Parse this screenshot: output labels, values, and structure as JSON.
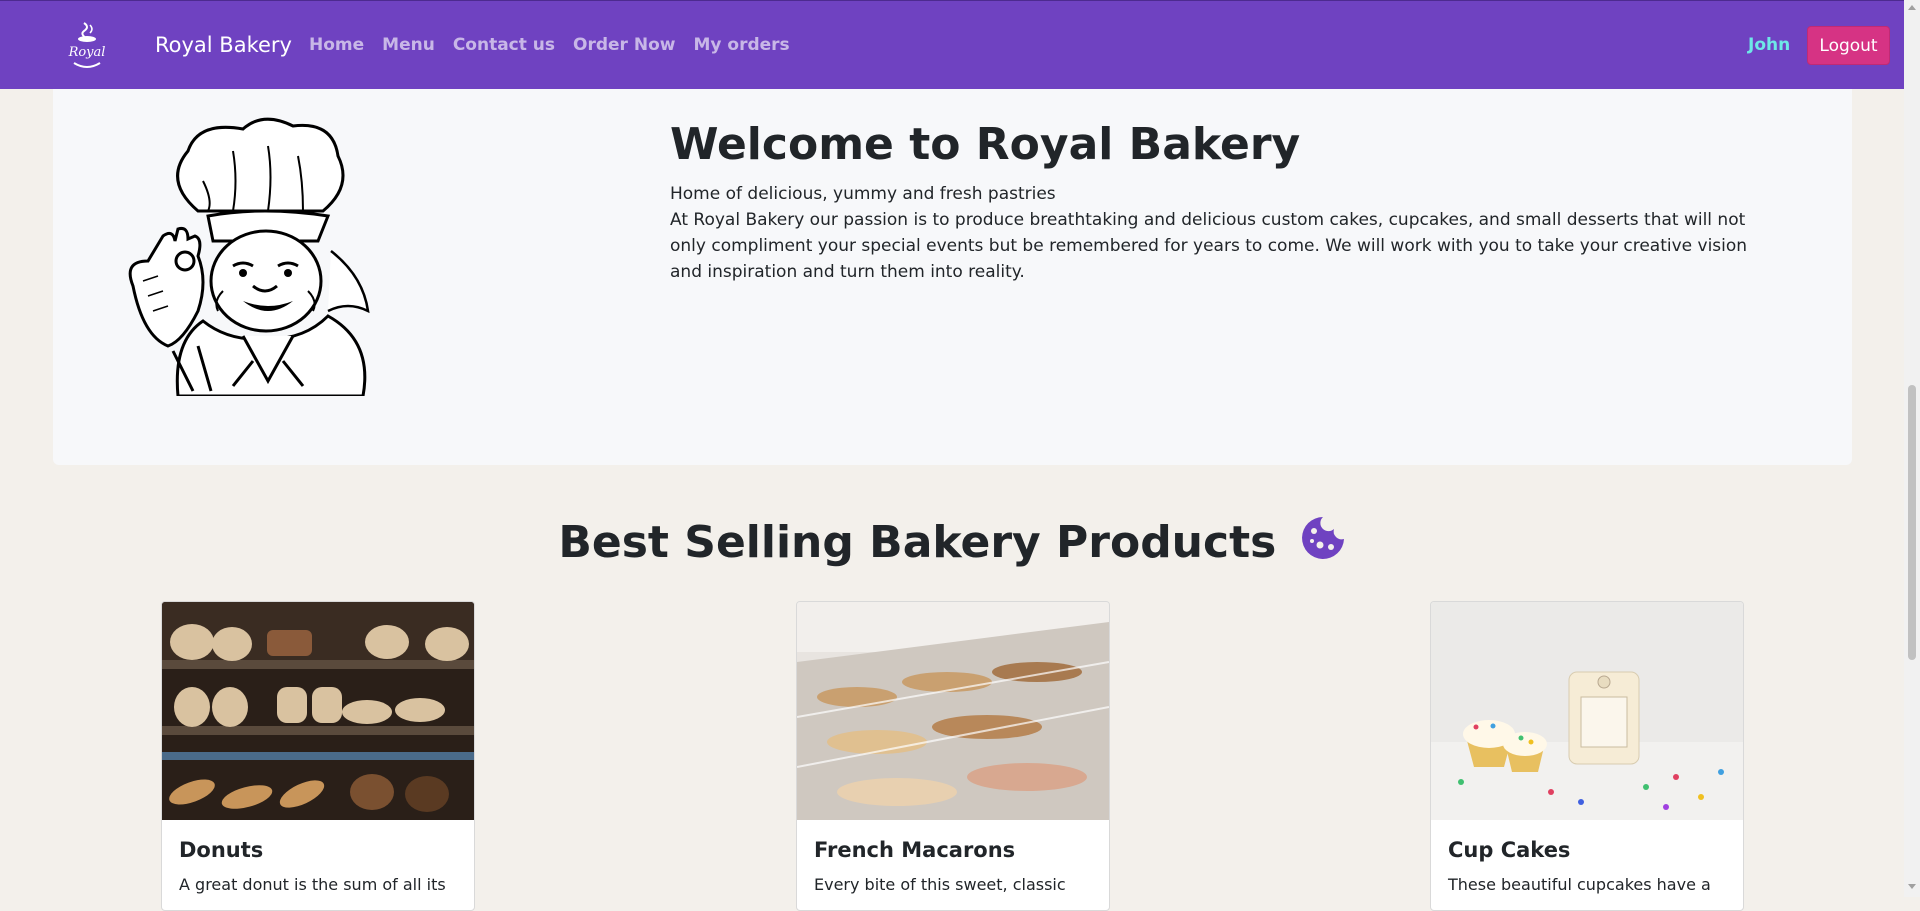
{
  "navbar": {
    "brand": "Royal Bakery",
    "logo_text": "Royal",
    "links": [
      "Home",
      "Menu",
      "Contact us",
      "Order Now",
      "My orders"
    ],
    "user": "John",
    "logout_label": "Logout",
    "bg_color": "#6f42c1"
  },
  "hero": {
    "title": "Welcome to Royal Bakery",
    "tagline": "Home of delicious, yummy and fresh pastries",
    "description": "At Royal Bakery our passion is to produce breathtaking and delicious custom cakes, cupcakes, and small desserts that will not only compliment your special events but be remembered for years to come. We will work with you to take your creative vision and inspiration and turn them into reality.",
    "image": "chef-illustration"
  },
  "products": {
    "title": "Best Selling Bakery Products",
    "title_icon": "cookie-icon",
    "items": [
      {
        "name": "Donuts",
        "text": "A great donut is the sum of all its",
        "image": "bread-shelf-photo"
      },
      {
        "name": "French Macarons",
        "text": "Every bite of this sweet, classic",
        "image": "pastry-display-photo"
      },
      {
        "name": "Cup Cakes",
        "text": "These beautiful cupcakes have a",
        "image": "cupcake-candle-photo"
      }
    ]
  },
  "colors": {
    "accent": "#6f42c1",
    "logout": "#d63384",
    "user": "#6ee7e7",
    "page_bg": "#f3f0eb"
  }
}
